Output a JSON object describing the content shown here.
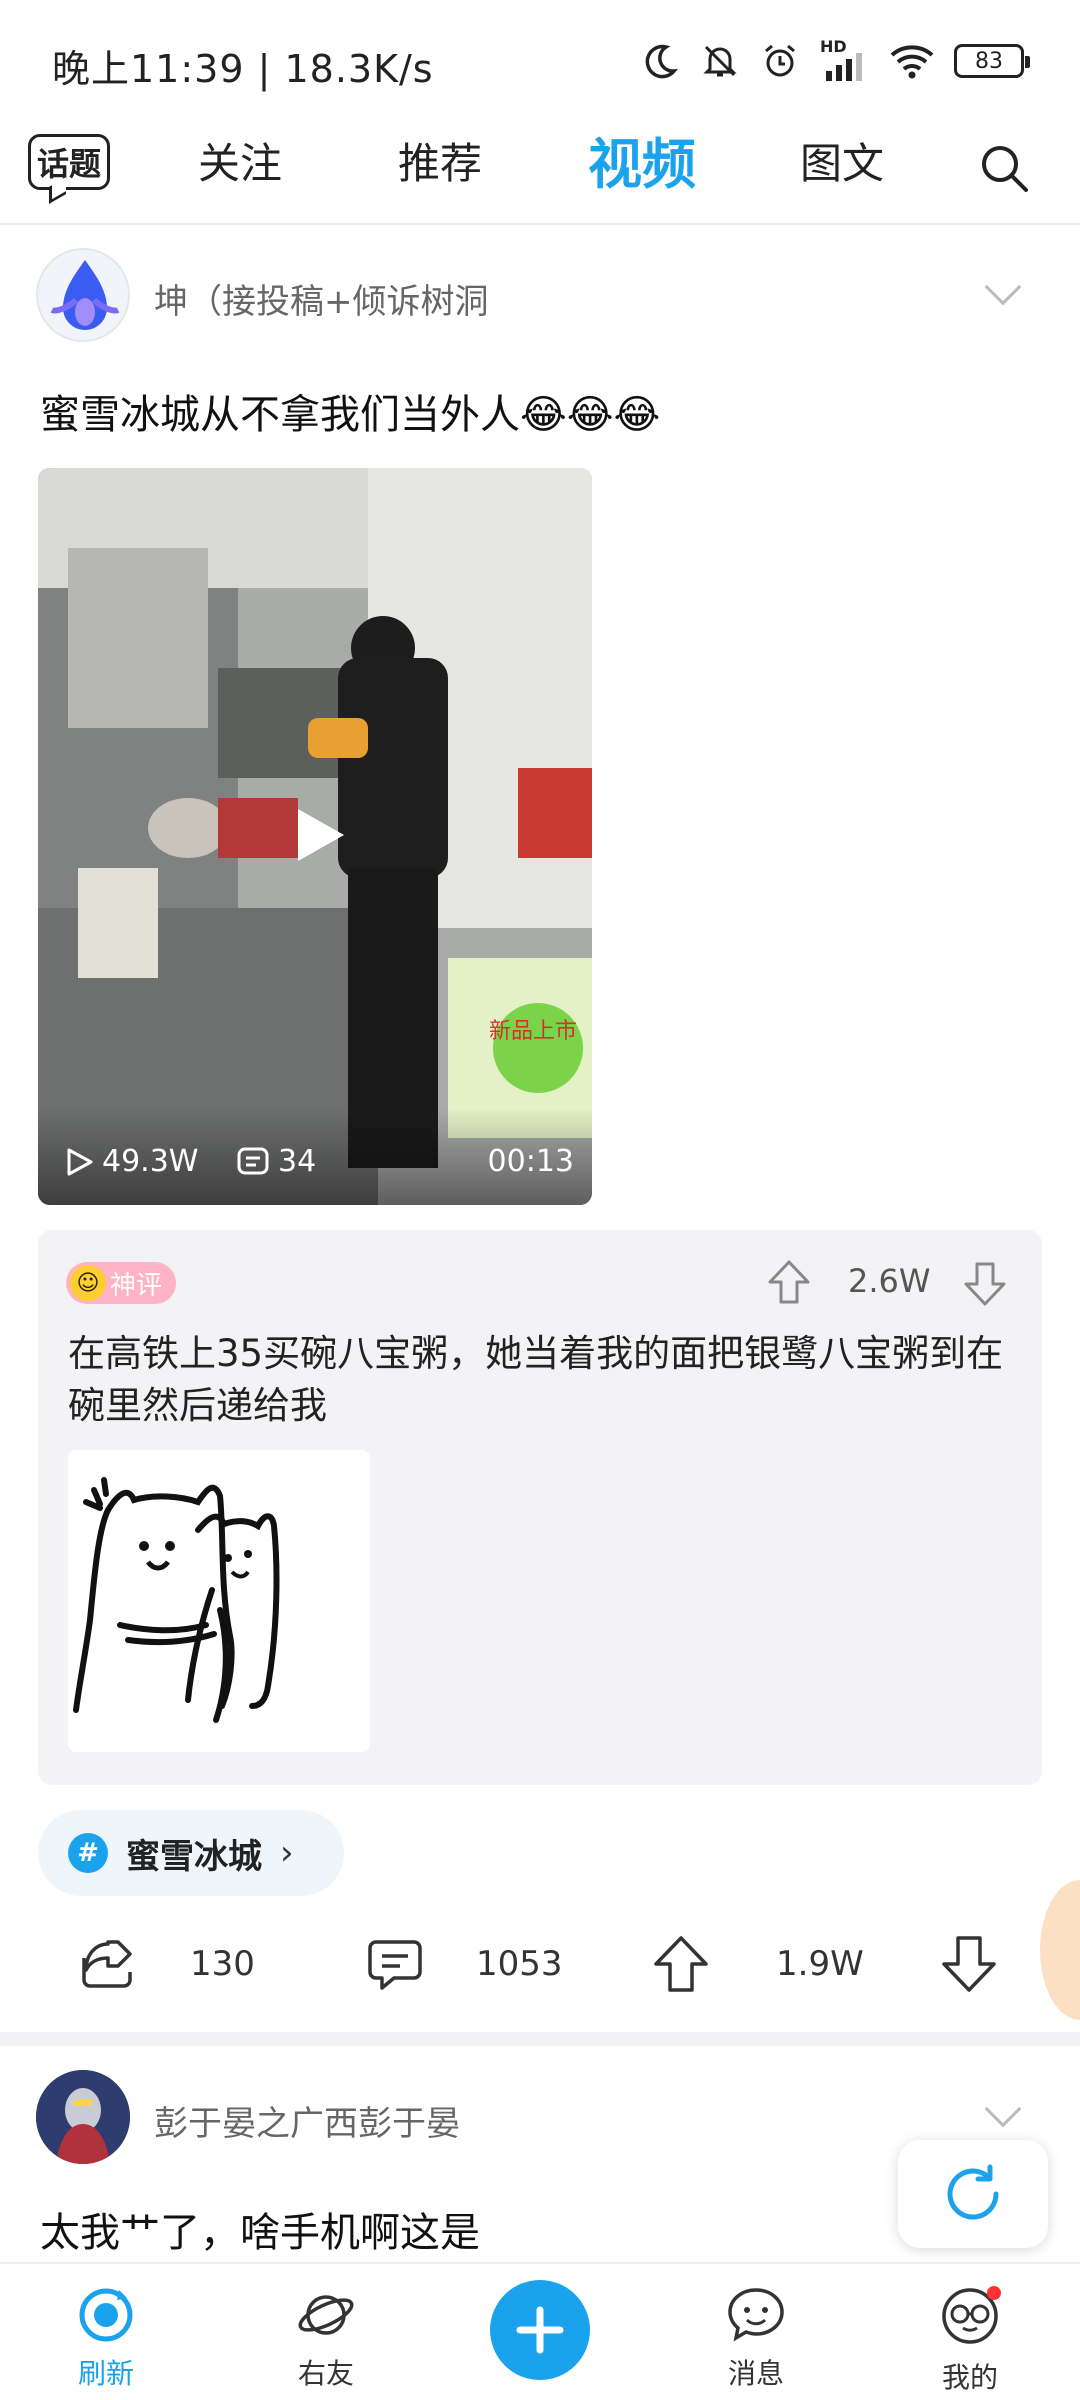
{
  "status_bar": {
    "time": "晚上11:39 | 18.3K/s",
    "battery": "83",
    "signal_label": "HD"
  },
  "nav": {
    "topic_button": "话题",
    "tabs": [
      {
        "label": "关注"
      },
      {
        "label": "推荐"
      },
      {
        "label": "视频"
      },
      {
        "label": "图文"
      }
    ],
    "active_tab": "视频"
  },
  "post1": {
    "username": "坤（接投稿+倾诉树洞",
    "title": "蜜雪冰城从不拿我们当外人😂😂😂",
    "video": {
      "plays": "49.3W",
      "comments": "34",
      "duration": "00:13",
      "sign_text": "新品上市"
    },
    "hot_comment": {
      "badge": "神评",
      "upvotes": "2.6W",
      "text": "在高铁上35买碗八宝粥，她当着我的面把银鹭八宝粥到在碗里然后递给我"
    },
    "topic": "蜜雪冰城",
    "actions": {
      "share": "130",
      "comment": "1053",
      "up": "1.9W"
    }
  },
  "post2": {
    "username": "彭于晏之广西彭于晏",
    "title": "太我艹了，啥手机啊这是"
  },
  "bottom_nav": [
    {
      "label": "刷新",
      "icon": "refresh-icon"
    },
    {
      "label": "右友",
      "icon": "planet-icon"
    },
    {
      "label": "消息",
      "icon": "message-icon"
    },
    {
      "label": "我的",
      "icon": "profile-icon"
    }
  ],
  "colors": {
    "accent": "#1aa3ec",
    "badge": "#ffb3c4"
  }
}
